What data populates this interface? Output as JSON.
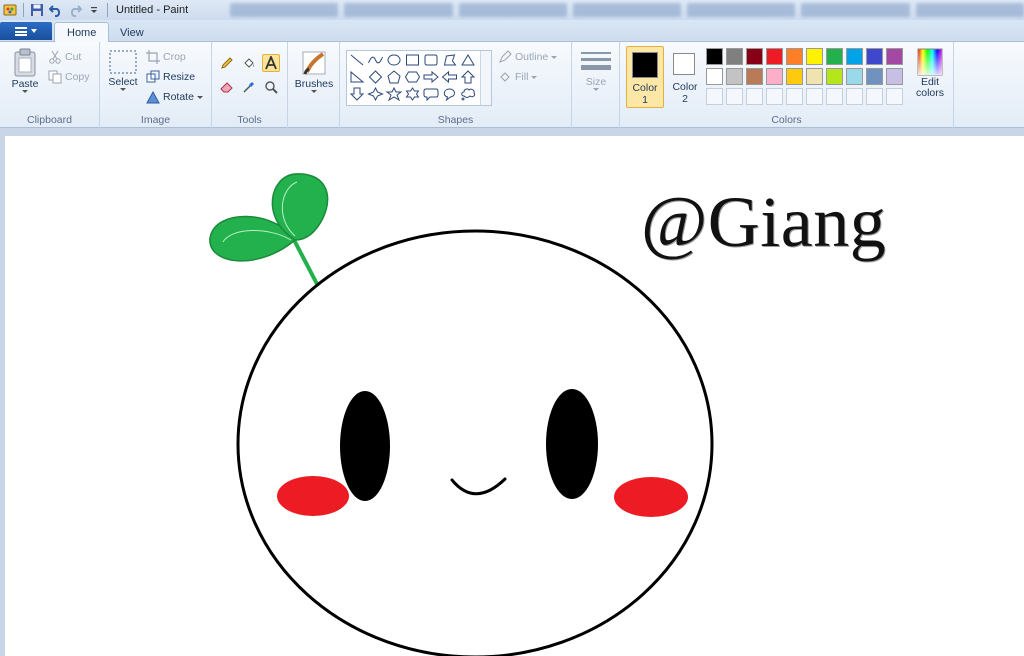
{
  "window": {
    "title": "Untitled - Paint"
  },
  "tabs": [
    {
      "label": "Home"
    },
    {
      "label": "View"
    }
  ],
  "clipboard": {
    "paste": "Paste",
    "cut": "Cut",
    "copy": "Copy",
    "group": "Clipboard"
  },
  "image": {
    "select": "Select",
    "crop": "Crop",
    "resize": "Resize",
    "rotate": "Rotate",
    "group": "Image"
  },
  "tools": {
    "group": "Tools",
    "selected": "text-tool"
  },
  "brushes": {
    "label": "Brushes"
  },
  "shapes": {
    "outline": "Outline",
    "fill": "Fill",
    "group": "Shapes"
  },
  "size": {
    "label": "Size"
  },
  "colors": {
    "color1_label": "Color",
    "color1_num": "1",
    "color2_label": "Color",
    "color2_num": "2",
    "edit_label_1": "Edit",
    "edit_label_2": "colors",
    "group": "Colors",
    "color1": "#000000",
    "color2": "#ffffff",
    "palette_row1": [
      "#000000",
      "#7f7f7f",
      "#880015",
      "#ed1c24",
      "#ff7f27",
      "#fff200",
      "#22b14c",
      "#00a2e8",
      "#3f48cc",
      "#a349a4"
    ],
    "palette_row2": [
      "#ffffff",
      "#c3c3c3",
      "#b97a57",
      "#ffaec9",
      "#ffc90e",
      "#efe4b0",
      "#b5e61d",
      "#99d9ea",
      "#7092be",
      "#c8bfe7"
    ]
  },
  "canvas": {
    "text": "@Giang",
    "colors": {
      "outline": "#000000",
      "leaf": "#22b14c",
      "cheek": "#ed1c24",
      "eye": "#000000"
    }
  }
}
